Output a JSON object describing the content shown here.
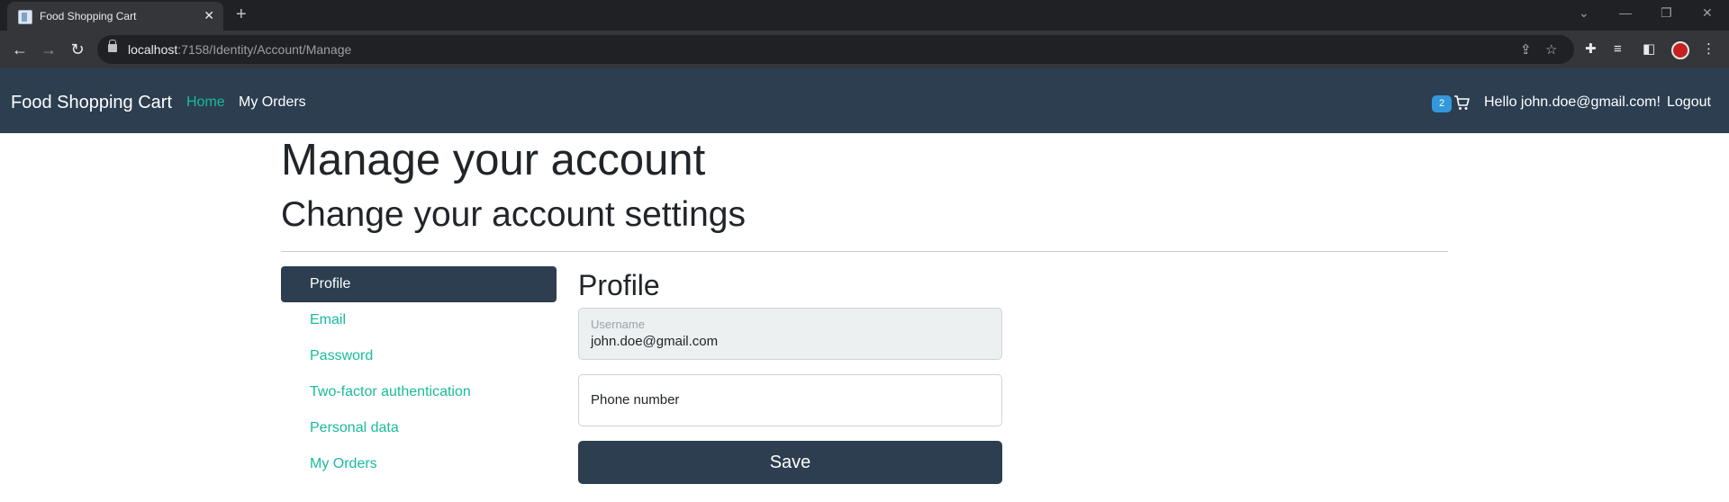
{
  "browser": {
    "tab_title": "Food Shopping Cart",
    "tab_close": "✕",
    "new_tab": "+",
    "url_host": "localhost",
    "url_path": ":7158/Identity/Account/Manage"
  },
  "navbar": {
    "brand": "Food Shopping Cart",
    "links": [
      "Home",
      "My Orders"
    ],
    "cart_count": "2",
    "greeting": "Hello john.doe@gmail.com!",
    "logout": "Logout",
    "colors": {
      "bg": "#2c3e50",
      "accent": "#18bc9c",
      "badge": "#3498db"
    }
  },
  "page": {
    "title": "Manage your account",
    "subtitle": "Change your account settings"
  },
  "sidebar": {
    "items": [
      "Profile",
      "Email",
      "Password",
      "Two-factor authentication",
      "Personal data",
      "My Orders"
    ],
    "active": "Profile"
  },
  "profile": {
    "heading": "Profile",
    "username_label": "Username",
    "username_value": "john.doe@gmail.com",
    "phone_label": "Phone number",
    "save_label": "Save"
  }
}
